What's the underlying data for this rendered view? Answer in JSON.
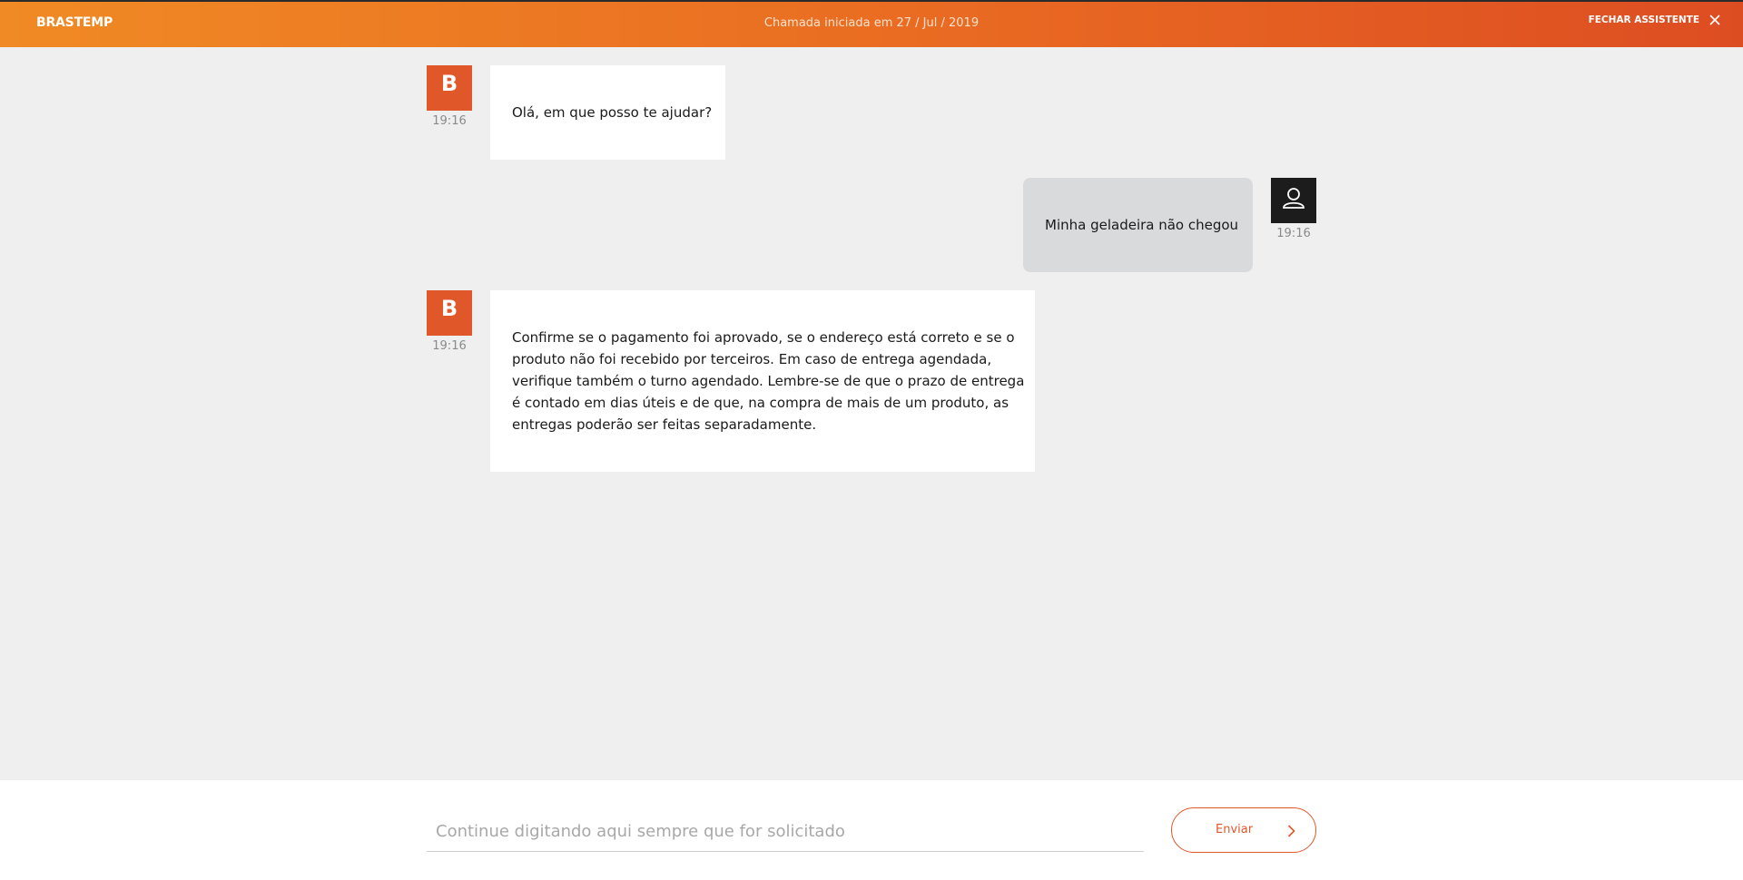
{
  "header": {
    "brand": "BRASTEMP",
    "title": "Chamada iniciada em 27 / Jul / 2019",
    "close_label": "FECHAR ASSISTENTE"
  },
  "messages": [
    {
      "sender": "bot",
      "time": "19:16",
      "text": "Olá, em que posso te ajudar?"
    },
    {
      "sender": "user",
      "time": "19:16",
      "text": "Minha geladeira não chegou"
    },
    {
      "sender": "bot",
      "time": "19:16",
      "lines": [
        "Confirme se o pagamento foi aprovado, se o endereço está correto e se o",
        "produto não foi recebido por terceiros. Em caso de entrega agendada,",
        "verifique também o turno agendado. Lembre-se de que o prazo de entrega",
        "é contado em dias úteis e de que, na compra de mais de um produto, as",
        "entregas poderão ser feitas separadamente."
      ]
    }
  ],
  "bot_avatar_letter": "B",
  "composer": {
    "placeholder": "Continue digitando aqui sempre que for solicitado",
    "send_label": "Enviar"
  },
  "colors": {
    "accent": "#e0582a",
    "header_start": "#f08a24",
    "header_end": "#dd4d22",
    "bot_avatar": "#e0582a",
    "user_avatar": "#1c1c1c",
    "user_bubble": "#d9dadb"
  },
  "icons": [
    "close-icon",
    "user-icon",
    "chevron-right-icon",
    "brastemp-b-icon"
  ]
}
